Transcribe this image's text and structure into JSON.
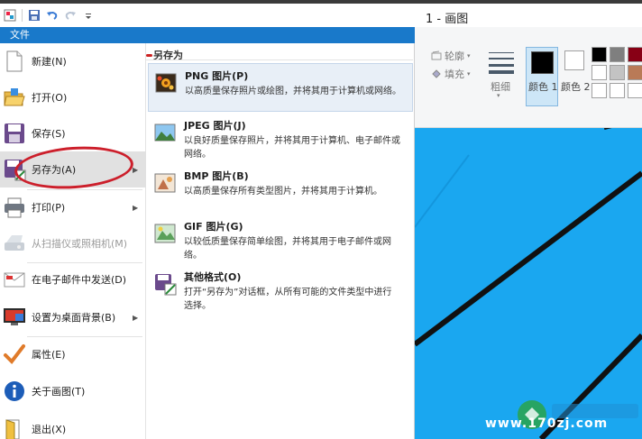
{
  "window": {
    "title": "1 - 画图"
  },
  "file_tab": {
    "label": "文件"
  },
  "ribbon": {
    "outline_label": "轮廓",
    "fill_label": "填充",
    "size_label": "粗细",
    "color1_label": "颜色 1",
    "color2_label": "颜色 2",
    "colors": {
      "color1": "#000000",
      "color2": "#ffffff",
      "accent": "#1979ca",
      "canvas": "#19a3ef"
    }
  },
  "file_menu": {
    "items": [
      {
        "label": "新建(N)",
        "icon": "new-document-icon"
      },
      {
        "label": "打开(O)",
        "icon": "open-folder-icon"
      },
      {
        "label": "保存(S)",
        "icon": "save-disk-icon"
      },
      {
        "label": "另存为(A)",
        "icon": "save-as-icon"
      },
      {
        "label": "打印(P)",
        "icon": "printer-icon"
      },
      {
        "label": "从扫描仪或照相机(M)",
        "icon": "scanner-icon"
      },
      {
        "label": "在电子邮件中发送(D)",
        "icon": "email-icon"
      },
      {
        "label": "设置为桌面背景(B)",
        "icon": "desktop-background-icon"
      },
      {
        "label": "属性(E)",
        "icon": "properties-check-icon"
      },
      {
        "label": "关于画图(T)",
        "icon": "info-icon"
      },
      {
        "label": "退出(X)",
        "icon": "exit-icon"
      }
    ]
  },
  "save_as_panel": {
    "header": "另存为",
    "items": [
      {
        "title": "PNG 图片(P)",
        "desc": "以高质量保存照片或绘图，并将其用于计算机或网络。",
        "icon": "png-image-icon"
      },
      {
        "title": "JPEG 图片(J)",
        "desc": "以良好质量保存照片，并将其用于计算机、电子邮件或网络。",
        "icon": "jpeg-image-icon"
      },
      {
        "title": "BMP 图片(B)",
        "desc": "以高质量保存所有类型图片，并将其用于计算机。",
        "icon": "bmp-image-icon"
      },
      {
        "title": "GIF 图片(G)",
        "desc": "以较低质量保存简单绘图，并将其用于电子邮件或网络。",
        "icon": "gif-image-icon"
      },
      {
        "title": "其他格式(O)",
        "desc": "打开“另存为”对话框，从所有可能的文件类型中进行选择。",
        "icon": "other-formats-icon"
      }
    ]
  },
  "watermark": {
    "text": "www.170zj.com"
  }
}
